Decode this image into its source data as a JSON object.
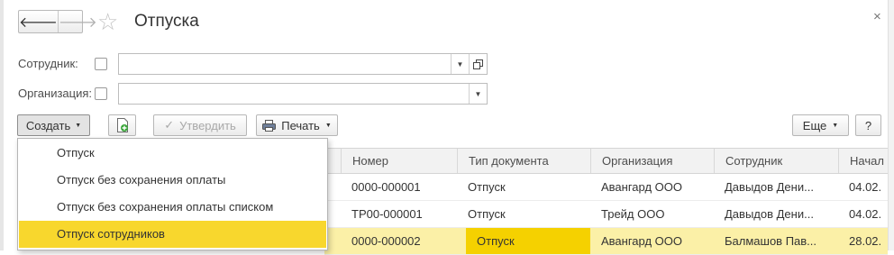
{
  "window": {
    "title": "Отпуска",
    "close_glyph": "×"
  },
  "nav": {
    "back_glyph": "🡐",
    "forward_glyph": "🡒",
    "star_glyph": "☆"
  },
  "filters": {
    "employee": {
      "label": "Сотрудник:",
      "value": ""
    },
    "organization": {
      "label": "Организация:",
      "value": ""
    }
  },
  "toolbar": {
    "create_label": "Создать",
    "approve_label": "Утвердить",
    "print_label": "Печать",
    "more_label": "Еще",
    "help_label": "?"
  },
  "create_menu": {
    "items": [
      "Отпуск",
      "Отпуск без сохранения оплаты",
      "Отпуск без сохранения оплаты списком",
      "Отпуск сотрудников"
    ],
    "highlighted_index": 3
  },
  "table": {
    "columns": [
      "Номер",
      "Тип документа",
      "Организация",
      "Сотрудник",
      "Начал"
    ],
    "rows": [
      [
        "0000-000001",
        "Отпуск",
        "Авангард ООО",
        "Давыдов Дени...",
        "04.02."
      ],
      [
        "ТР00-000001",
        "Отпуск",
        "Трейд ООО",
        "Давыдов Дени...",
        "04.02."
      ],
      [
        "0000-000002",
        "Отпуск",
        "Авангард ООО",
        "Балмашов Пав...",
        "28.02."
      ]
    ],
    "selected_row": 2
  },
  "colors": {
    "menu_highlight": "#f8d72d",
    "row_selected": "#fbf0a7",
    "current_cell": "#f5d100"
  }
}
